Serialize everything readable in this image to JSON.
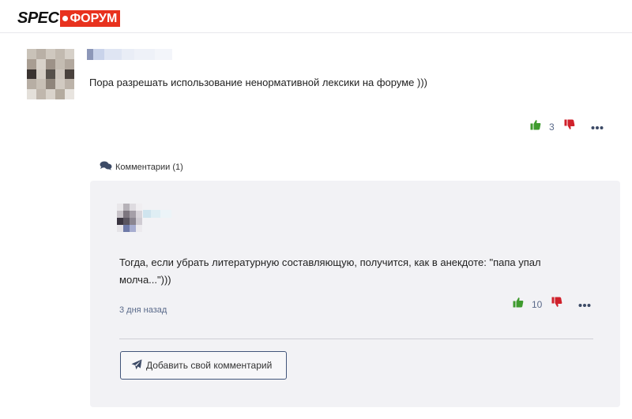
{
  "header": {
    "logo_spec": "SPEC",
    "logo_forum": "ФОРУМ",
    "brand_color": "#e8321e"
  },
  "post": {
    "text": "Пора разрешать использование ненормативной лексики на форуме )))",
    "likes": "3",
    "icons": {
      "like": "thumbs-up-icon",
      "dislike": "thumbs-down-icon",
      "more": "more-dots-icon"
    }
  },
  "comments_section": {
    "label": "Комментарии (1)",
    "icon": "comments-icon"
  },
  "comment": {
    "text": "Тогда, если убрать литературную составляющую, получится, как в анекдоте: \"папа упал молча...\")))",
    "date": "3 дня назад",
    "likes": "10"
  },
  "add_comment": {
    "label": "Добавить свой комментарий",
    "icon": "send-icon"
  },
  "colors": {
    "like": "#3f9b2e",
    "dislike": "#d0212b",
    "meta_text": "#5a6a8a",
    "comment_bg": "#f2f2f5",
    "button_border": "#42557a"
  }
}
